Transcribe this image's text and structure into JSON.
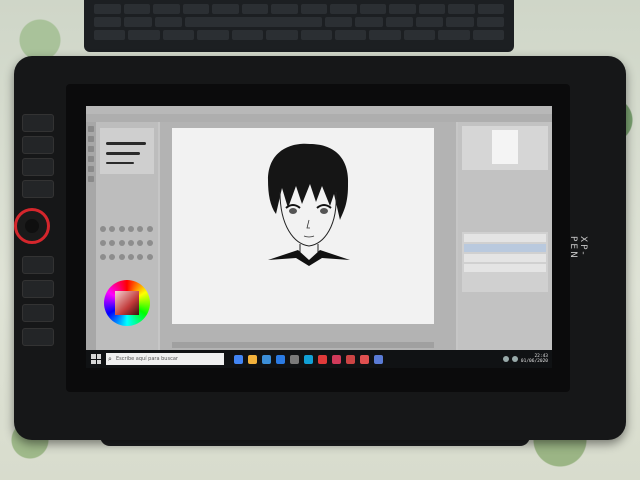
{
  "taskbar": {
    "search_placeholder": "Escribe aquí para buscar",
    "time": "22:43",
    "date": "01/06/2020",
    "apps": [
      "chrome-icon",
      "explorer-icon",
      "mail-icon",
      "dropbox-icon",
      "store-icon",
      "vpn-icon",
      "photoshop-icon",
      "media-icon",
      "app-icon",
      "record-icon",
      "clip-studio-icon"
    ]
  },
  "tablet": {
    "brand_text": "XP-PEN"
  },
  "colors": {
    "dial_ring": "#d4262c",
    "tablet_body": "#161718",
    "canvas": "#f2f2f2"
  },
  "app_colors": [
    "#4285f4",
    "#f2b13b",
    "#3c8fd8",
    "#2b7be4",
    "#7a7a7a",
    "#11a0d6",
    "#e03a3a",
    "#d03a5a",
    "#c44",
    "#e05050",
    "#5a7bd6"
  ]
}
